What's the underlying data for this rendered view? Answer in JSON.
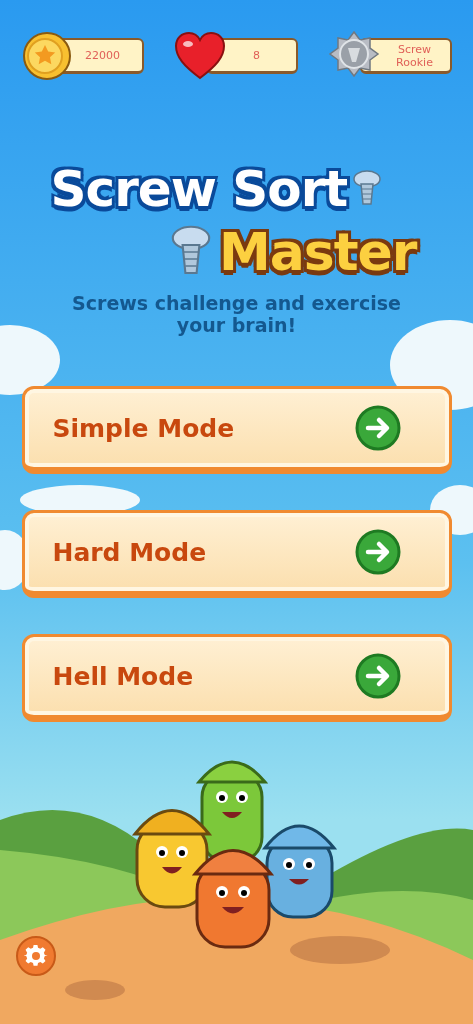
{
  "stats": [
    {
      "kind": "coins",
      "value": "22000"
    },
    {
      "kind": "lives",
      "value": "8"
    },
    {
      "kind": "rank",
      "value": "Screw Rookie"
    }
  ],
  "title": {
    "line_1": "Screw Sort",
    "line_2": "Master"
  },
  "subtitle": "Screws challenge and exercise your brain!",
  "modes": [
    {
      "label": "Simple Mode"
    },
    {
      "label": "Hard Mode"
    },
    {
      "label": "Hell Mode"
    }
  ]
}
